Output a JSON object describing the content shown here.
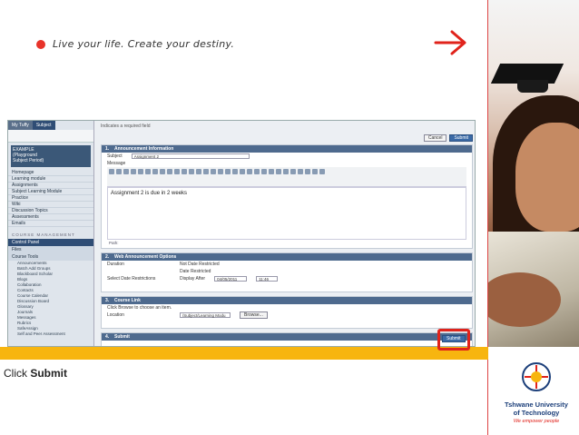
{
  "header": {
    "tagline": "Live your life. Create your destiny."
  },
  "caption": {
    "prefix": "Click ",
    "target": "Submit"
  },
  "logo": {
    "name_line1": "Tshwane University",
    "name_line2": "of Technology",
    "tagline": "We empower people"
  },
  "colors": {
    "accent_red": "#e0231b",
    "band_orange": "#f7b50f",
    "nav_blue": "#2f4d75"
  },
  "icons": {
    "arrow": "arrow-right-icon",
    "bullet": "red-dot-icon"
  },
  "screenshot": {
    "sidebar": {
      "tabs": [
        "My Tuffy",
        "Subject"
      ],
      "course_title": "EXAMPLE",
      "course_lines": [
        "(Playground",
        "Subject Period)"
      ],
      "items": [
        "Homepage",
        "Learning module",
        "Assignments",
        "Subject Learning Module",
        "Practice",
        "Wiki",
        "Discussion Topics",
        "Assessments",
        "Emails"
      ],
      "course_management": "COURSE MANAGEMENT",
      "control_panel": "Control Panel",
      "files": "Files",
      "tools": [
        "Course Tools",
        "Announcements",
        "Batch Add Groups",
        "Blackboard Scholar",
        "Blogs",
        "Collaboration",
        "Contacts",
        "Course Calendar",
        "Discussion Board",
        "Glossary",
        "Journals",
        "Messages",
        "Rubrics",
        "SafeAssign",
        "Self and Peer Assessment",
        "Send Email",
        "SoftChalk Publish with Scorm",
        "Tasks",
        "Tests, Surveys and Pools"
      ]
    },
    "required_note": "Indicates a required field",
    "buttons": {
      "cancel": "Cancel",
      "submit": "Submit"
    },
    "announcement": {
      "num": "1.",
      "title": "Announcement Information",
      "subject_label": "Subject",
      "subject_value": "Assignment 2",
      "message_label": "Message",
      "body": "Assignment 2 is due in 2 weeks",
      "path_label": "Path:"
    },
    "web_options": {
      "num": "2.",
      "title": "Web Announcement Options",
      "duration_label": "Duration",
      "opt_not_restricted": "Not Date Restricted",
      "opt_restricted": "Date Restricted",
      "restrictions_label": "Select Date Restrictions",
      "display_after": "Display After",
      "display_after_date": "04/05/2011",
      "display_after_time": "11:46",
      "display_until": "Display Until",
      "display_until_date": "05/05/2011",
      "display_until_time": "14:53"
    },
    "course_link": {
      "num": "3.",
      "title": "Course Link",
      "hint": "Click Browse to choose an item.",
      "location_label": "Location",
      "location_value": "/Subject/Learning Modu",
      "browse": "Browse..."
    },
    "submit_section": {
      "num": "4.",
      "title": "Submit"
    }
  }
}
